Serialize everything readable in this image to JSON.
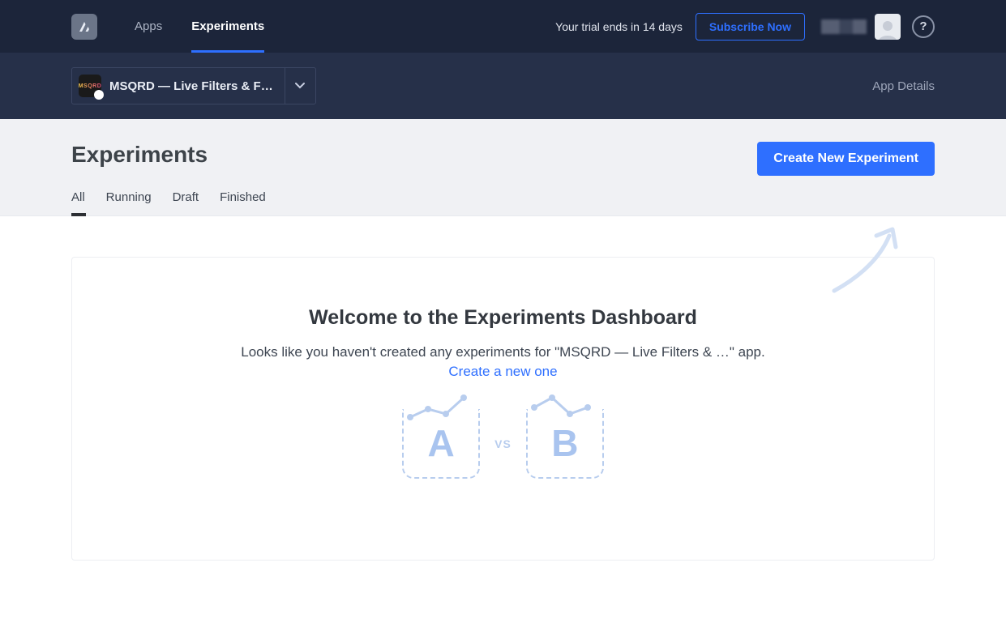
{
  "nav": {
    "apps": "Apps",
    "experiments": "Experiments"
  },
  "header": {
    "trial_text": "Your trial ends in 14 days",
    "subscribe_label": "Subscribe Now",
    "help_glyph": "?"
  },
  "subbar": {
    "app_name": "MSQRD — Live Filters & F…",
    "app_icon_text": "MSQRD",
    "apple_glyph": "",
    "app_details": "App Details"
  },
  "page": {
    "title": "Experiments",
    "create_btn": "Create New Experiment",
    "tabs": {
      "all": "All",
      "running": "Running",
      "draft": "Draft",
      "finished": "Finished"
    }
  },
  "empty": {
    "heading": "Welcome to the Experiments Dashboard",
    "body": "Looks like you haven't created any experiments for \"MSQRD — Live Filters & …\" app.",
    "link": "Create a new one",
    "letter_a": "A",
    "letter_b": "B",
    "vs": "VS"
  }
}
